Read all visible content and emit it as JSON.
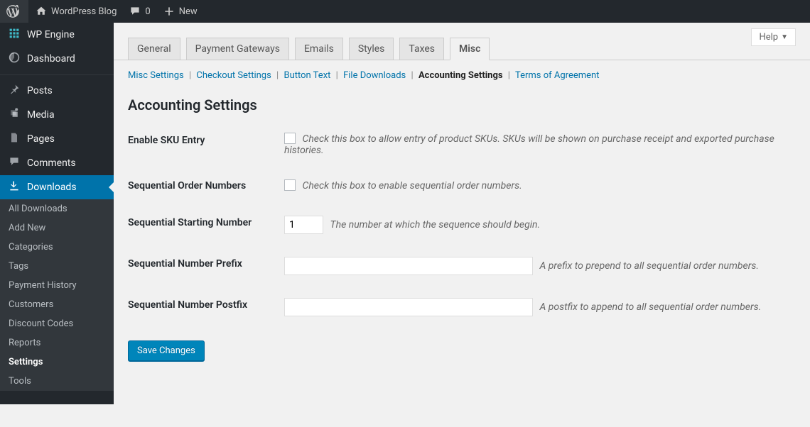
{
  "topbar": {
    "site_name": "WordPress Blog",
    "comments_count": "0",
    "new_label": "New"
  },
  "help": {
    "label": "Help"
  },
  "menu": {
    "wp_engine": "WP Engine",
    "dashboard": "Dashboard",
    "posts": "Posts",
    "media": "Media",
    "pages": "Pages",
    "comments": "Comments",
    "downloads": "Downloads"
  },
  "submenu": {
    "all_downloads": "All Downloads",
    "add_new": "Add New",
    "categories": "Categories",
    "tags": "Tags",
    "payment_history": "Payment History",
    "customers": "Customers",
    "discount_codes": "Discount Codes",
    "reports": "Reports",
    "settings": "Settings",
    "tools": "Tools"
  },
  "tabs": {
    "general": "General",
    "payment_gateways": "Payment Gateways",
    "emails": "Emails",
    "styles": "Styles",
    "taxes": "Taxes",
    "misc": "Misc"
  },
  "subnav": {
    "misc_settings": "Misc Settings",
    "checkout_settings": "Checkout Settings",
    "button_text": "Button Text",
    "file_downloads": "File Downloads",
    "accounting_settings": "Accounting Settings",
    "terms_of_agreement": "Terms of Agreement"
  },
  "section": {
    "title": "Accounting Settings"
  },
  "fields": {
    "enable_sku": {
      "label": "Enable SKU Entry",
      "desc": "Check this box to allow entry of product SKUs. SKUs will be shown on purchase receipt and exported purchase histories."
    },
    "sequential_order_numbers": {
      "label": "Sequential Order Numbers",
      "desc": "Check this box to enable sequential order numbers."
    },
    "sequential_starting_number": {
      "label": "Sequential Starting Number",
      "value": "1",
      "desc": "The number at which the sequence should begin."
    },
    "sequential_prefix": {
      "label": "Sequential Number Prefix",
      "value": "",
      "desc": "A prefix to prepend to all sequential order numbers."
    },
    "sequential_postfix": {
      "label": "Sequential Number Postfix",
      "value": "",
      "desc": "A postfix to append to all sequential order numbers."
    }
  },
  "submit": {
    "save": "Save Changes"
  }
}
